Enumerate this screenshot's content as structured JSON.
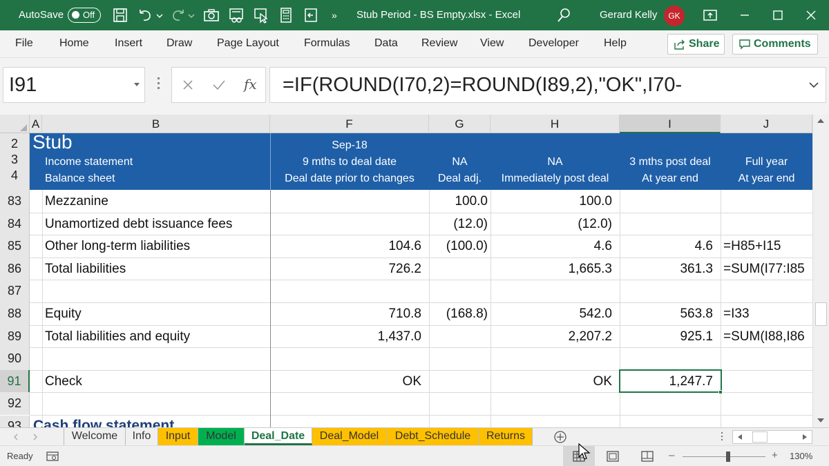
{
  "titlebar": {
    "autosave_label": "AutoSave",
    "autosave_state": "Off",
    "overflow": "»",
    "document_title": "Stub Period - BS Empty.xlsx  -  Excel",
    "user_name": "Gerard Kelly",
    "user_initials": "GK",
    "color": "#217346"
  },
  "menu": {
    "items": [
      "File",
      "Home",
      "Insert",
      "Draw",
      "Page Layout",
      "Formulas",
      "Data",
      "Review",
      "View",
      "Developer",
      "Help"
    ],
    "share_label": "Share",
    "comments_label": "Comments"
  },
  "formula_bar": {
    "name_box": "I91",
    "formula": "=IF(ROUND(I70,2)=ROUND(I89,2),\"OK\",I70-",
    "fx_label": "fx"
  },
  "grid": {
    "columns": [
      "A",
      "B",
      "F",
      "G",
      "H",
      "I",
      "J"
    ],
    "header_band": {
      "color": "#1f5fa8",
      "row_numbers": [
        "2",
        "3",
        "4"
      ],
      "stub_title": "Stub",
      "b_line1": "Income statement",
      "b_line2": "Balance sheet",
      "f_line0": "Sep-18",
      "f_line1": "9 mths to deal date",
      "f_line2": "Deal date prior to changes",
      "g_line1": "NA",
      "g_line2": "Deal adj.",
      "h_line1": "NA",
      "h_line2": "Immediately post deal",
      "i_line1": "3 mths post deal",
      "i_line2": "At year end",
      "j_line1": "Full year",
      "j_line2": "At year end"
    },
    "rows": [
      {
        "num": "83",
        "label": "Mezzanine",
        "f": "",
        "g": "100.0",
        "h": "100.0",
        "i": "",
        "j": ""
      },
      {
        "num": "84",
        "label": "Unamortized debt issuance fees",
        "f": "",
        "g": "(12.0)",
        "h": "(12.0)",
        "i": "",
        "j": ""
      },
      {
        "num": "85",
        "label": "Other long-term liabilities",
        "f": "104.6",
        "g": "(100.0)",
        "h": "4.6",
        "i": "4.6",
        "j": "=H85+I15"
      },
      {
        "num": "86",
        "label": "Total liabilities",
        "f": "726.2",
        "g": "",
        "h": "1,665.3",
        "i": "361.3",
        "j": "=SUM(I77:I85"
      },
      {
        "num": "87",
        "label": "",
        "f": "",
        "g": "",
        "h": "",
        "i": "",
        "j": ""
      },
      {
        "num": "88",
        "label": "Equity",
        "f": "710.8",
        "g": "(168.8)",
        "h": "542.0",
        "i": "563.8",
        "j": "=I33"
      },
      {
        "num": "89",
        "label": "Total liabilities and equity",
        "f": "1,437.0",
        "g": "",
        "h": "2,207.2",
        "i": "925.1",
        "j": "=SUM(I88,I86"
      },
      {
        "num": "90",
        "label": "",
        "f": "",
        "g": "",
        "h": "",
        "i": "",
        "j": ""
      },
      {
        "num": "91",
        "label": "Check",
        "f": "OK",
        "g": "",
        "h": "OK",
        "i": "1,247.7",
        "j": ""
      },
      {
        "num": "92",
        "label": "",
        "f": "",
        "g": "",
        "h": "",
        "i": "",
        "j": ""
      }
    ],
    "partial_row": {
      "num": "93",
      "label": "Cash flow statement"
    }
  },
  "sheet_tabs": [
    {
      "label": "Welcome",
      "color": "#f0f0f0"
    },
    {
      "label": "Info",
      "color": "#f0f0f0"
    },
    {
      "label": "Input",
      "color": "#ffc000"
    },
    {
      "label": "Model",
      "color": "#00b050"
    },
    {
      "label": "Deal_Date",
      "color": "#ffffff"
    },
    {
      "label": "Deal_Model",
      "color": "#ffc000"
    },
    {
      "label": "Debt_Schedule",
      "color": "#ffc000"
    },
    {
      "label": "Returns",
      "color": "#ffc000"
    }
  ],
  "status": {
    "ready": "Ready",
    "zoom_minus": "–",
    "zoom_plus": "+",
    "zoom": "130%"
  }
}
